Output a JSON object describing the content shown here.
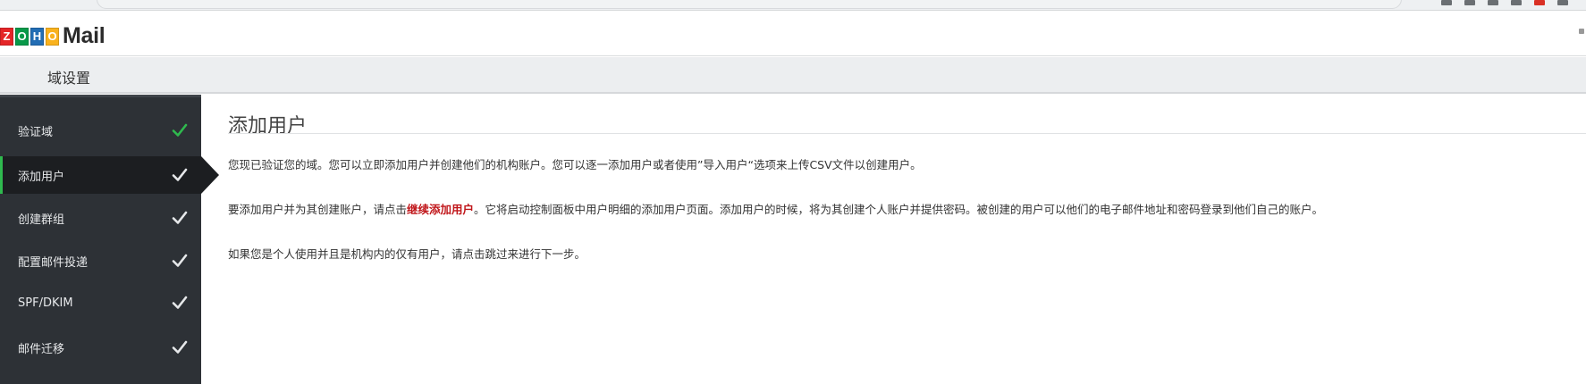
{
  "app": {
    "logo_letters": [
      "Z",
      "O",
      "H",
      "O"
    ],
    "logo_colors": [
      "#e42527",
      "#089949",
      "#226db4",
      "#f9b21d"
    ],
    "logo_word": "Mail"
  },
  "settings_bar": {
    "title": "域设置"
  },
  "sidebar": {
    "items": [
      {
        "label": "验证域",
        "status": "done",
        "check_color": "#2fb94e"
      },
      {
        "label": "添加用户",
        "status": "current",
        "check_color": "#e6e8ea"
      },
      {
        "label": "创建群组",
        "status": "pending",
        "check_color": "#e6e8ea"
      },
      {
        "label": "配置邮件投递",
        "status": "pending",
        "check_color": "#e6e8ea"
      },
      {
        "label": "SPF/DKIM",
        "status": "pending",
        "check_color": "#e6e8ea"
      },
      {
        "label": "邮件迁移",
        "status": "pending",
        "check_color": "#e6e8ea"
      }
    ]
  },
  "main": {
    "title": "添加用户",
    "para1": "您现已验证您的域。您可以立即添加用户并创建他们的机构账户。您可以逐一添加用户或者使用”导入用户“选项来上传CSV文件以创建用户。",
    "para2_before": "要添加用户并为其创建账户，请点击",
    "para2_link": "继续添加用户",
    "para2_after": "。它将启动控制面板中用户明细的添加用户页面。添加用户的时候，将为其创建个人账户并提供密码。被创建的用户可以他们的电子邮件地址和密码登录到他们自己的账户。",
    "para3": "如果您是个人使用并且是机构内的仅有用户，请点击跳过来进行下一步。"
  },
  "colors": {
    "sidebar_bg": "#2d3136",
    "active_bg": "#1c1e21",
    "accent_green": "#2fb94e",
    "link_red": "#c0161a"
  }
}
